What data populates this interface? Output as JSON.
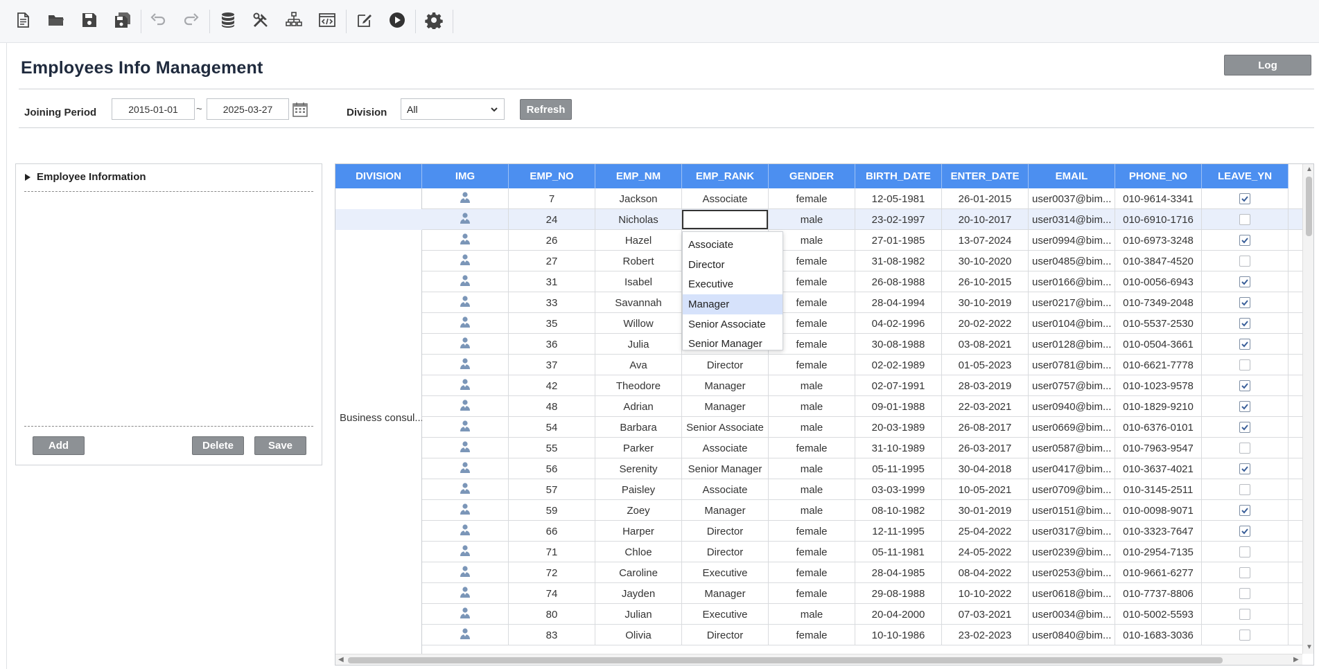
{
  "toolbar": {
    "icons": [
      "new-file-icon",
      "open-folder-icon",
      "save-icon",
      "save-all-icon",
      "undo-icon",
      "redo-icon",
      "database-icon",
      "tools-icon",
      "hierarchy-icon",
      "code-window-icon",
      "edit-icon",
      "run-icon",
      "settings-icon"
    ]
  },
  "page": {
    "title": "Employees Info Management",
    "log_label": "Log"
  },
  "filters": {
    "joining_period_label": "Joining Period",
    "date_from": "2015-01-01",
    "tilde": "~",
    "date_to": "2025-03-27",
    "division_label": "Division",
    "division_value": "All",
    "refresh_label": "Refresh"
  },
  "tree": {
    "header": "Employee Information",
    "add_label": "Add",
    "delete_label": "Delete",
    "save_label": "Save"
  },
  "grid": {
    "columns": [
      "DIVISION",
      "IMG",
      "EMP_NO",
      "EMP_NM",
      "EMP_RANK",
      "GENDER",
      "BIRTH_DATE",
      "ENTER_DATE",
      "EMAIL",
      "PHONE_NO",
      "LEAVE_YN"
    ],
    "division_value": "Business consul...",
    "rows": [
      {
        "no": "7",
        "name": "Jackson",
        "rank": "Associate",
        "gender": "female",
        "birth": "12-05-1981",
        "enter": "26-01-2015",
        "email": "user0037@bim...",
        "phone": "010-9614-3341",
        "leave": true
      },
      {
        "no": "24",
        "name": "Nicholas",
        "rank": "",
        "gender": "male",
        "birth": "23-02-1997",
        "enter": "20-10-2017",
        "email": "user0314@bim...",
        "phone": "010-6910-1716",
        "leave": false
      },
      {
        "no": "26",
        "name": "Hazel",
        "rank": "",
        "gender": "male",
        "birth": "27-01-1985",
        "enter": "13-07-2024",
        "email": "user0994@bim...",
        "phone": "010-6973-3248",
        "leave": true
      },
      {
        "no": "27",
        "name": "Robert",
        "rank": "",
        "gender": "female",
        "birth": "31-08-1982",
        "enter": "30-10-2020",
        "email": "user0485@bim...",
        "phone": "010-3847-4520",
        "leave": false
      },
      {
        "no": "31",
        "name": "Isabel",
        "rank": "",
        "gender": "female",
        "birth": "26-08-1988",
        "enter": "26-10-2015",
        "email": "user0166@bim...",
        "phone": "010-0056-6943",
        "leave": true
      },
      {
        "no": "33",
        "name": "Savannah",
        "rank": "",
        "gender": "female",
        "birth": "28-04-1994",
        "enter": "30-10-2019",
        "email": "user0217@bim...",
        "phone": "010-7349-2048",
        "leave": true
      },
      {
        "no": "35",
        "name": "Willow",
        "rank": "",
        "gender": "female",
        "birth": "04-02-1996",
        "enter": "20-02-2022",
        "email": "user0104@bim...",
        "phone": "010-5537-2530",
        "leave": true
      },
      {
        "no": "36",
        "name": "Julia",
        "rank": "",
        "gender": "female",
        "birth": "30-08-1988",
        "enter": "03-08-2021",
        "email": "user0128@bim...",
        "phone": "010-0504-3661",
        "leave": true
      },
      {
        "no": "37",
        "name": "Ava",
        "rank": "Director",
        "gender": "female",
        "birth": "02-02-1989",
        "enter": "01-05-2023",
        "email": "user0781@bim...",
        "phone": "010-6621-7778",
        "leave": false
      },
      {
        "no": "42",
        "name": "Theodore",
        "rank": "Manager",
        "gender": "male",
        "birth": "02-07-1991",
        "enter": "28-03-2019",
        "email": "user0757@bim...",
        "phone": "010-1023-9578",
        "leave": true
      },
      {
        "no": "48",
        "name": "Adrian",
        "rank": "Manager",
        "gender": "male",
        "birth": "09-01-1988",
        "enter": "22-03-2021",
        "email": "user0940@bim...",
        "phone": "010-1829-9210",
        "leave": true
      },
      {
        "no": "54",
        "name": "Barbara",
        "rank": "Senior Associate",
        "gender": "male",
        "birth": "20-03-1989",
        "enter": "26-08-2017",
        "email": "user0669@bim...",
        "phone": "010-6376-0101",
        "leave": true
      },
      {
        "no": "55",
        "name": "Parker",
        "rank": "Associate",
        "gender": "female",
        "birth": "31-10-1989",
        "enter": "26-03-2017",
        "email": "user0587@bim...",
        "phone": "010-7963-9547",
        "leave": false
      },
      {
        "no": "56",
        "name": "Serenity",
        "rank": "Senior Manager",
        "gender": "male",
        "birth": "05-11-1995",
        "enter": "30-04-2018",
        "email": "user0417@bim...",
        "phone": "010-3637-4021",
        "leave": true
      },
      {
        "no": "57",
        "name": "Paisley",
        "rank": "Associate",
        "gender": "male",
        "birth": "03-03-1999",
        "enter": "10-05-2021",
        "email": "user0709@bim...",
        "phone": "010-3145-2511",
        "leave": false
      },
      {
        "no": "59",
        "name": "Zoey",
        "rank": "Manager",
        "gender": "male",
        "birth": "08-10-1982",
        "enter": "30-01-2019",
        "email": "user0151@bim...",
        "phone": "010-0098-9071",
        "leave": true
      },
      {
        "no": "66",
        "name": "Harper",
        "rank": "Director",
        "gender": "female",
        "birth": "12-11-1995",
        "enter": "25-04-2022",
        "email": "user0317@bim...",
        "phone": "010-3323-7647",
        "leave": true
      },
      {
        "no": "71",
        "name": "Chloe",
        "rank": "Director",
        "gender": "female",
        "birth": "05-11-1981",
        "enter": "24-05-2022",
        "email": "user0239@bim...",
        "phone": "010-2954-7135",
        "leave": false
      },
      {
        "no": "72",
        "name": "Caroline",
        "rank": "Executive",
        "gender": "female",
        "birth": "28-04-1985",
        "enter": "08-04-2022",
        "email": "user0253@bim...",
        "phone": "010-9661-6277",
        "leave": false
      },
      {
        "no": "74",
        "name": "Jayden",
        "rank": "Manager",
        "gender": "female",
        "birth": "29-08-1988",
        "enter": "10-10-2022",
        "email": "user0618@bim...",
        "phone": "010-7737-8806",
        "leave": false
      },
      {
        "no": "80",
        "name": "Julian",
        "rank": "Executive",
        "gender": "male",
        "birth": "20-04-2000",
        "enter": "07-03-2021",
        "email": "user0034@bim...",
        "phone": "010-5002-5593",
        "leave": false
      },
      {
        "no": "83",
        "name": "Olivia",
        "rank": "Director",
        "gender": "female",
        "birth": "10-10-1986",
        "enter": "23-02-2023",
        "email": "user0840@bim...",
        "phone": "010-1683-3036",
        "leave": false
      }
    ],
    "rank_options": [
      "Associate",
      "Director",
      "Executive",
      "Manager",
      "Senior Associate",
      "Senior Manager"
    ],
    "rank_highlighted": "Manager"
  },
  "colors": {
    "header_blue": "#4c8ff0",
    "button_gray": "#8d9195",
    "selected_row": "#e9effb",
    "dropdown_highlight": "#d6e2fb"
  }
}
